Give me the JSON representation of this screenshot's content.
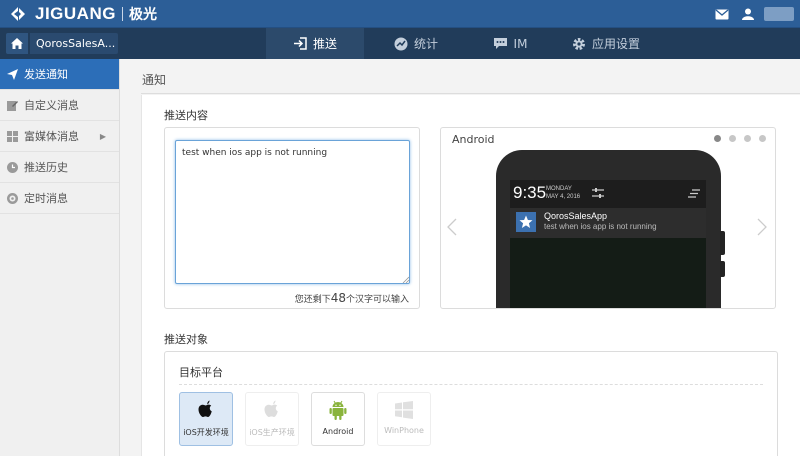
{
  "header": {
    "brand": "JIGUANG",
    "brand_cn": "极光"
  },
  "nav": {
    "app_name": "QorosSalesA...",
    "tabs": [
      {
        "label": "推送",
        "icon": "push-icon",
        "active": true
      },
      {
        "label": "统计",
        "icon": "stats-icon",
        "active": false
      },
      {
        "label": "IM",
        "icon": "chat-icon",
        "active": false
      },
      {
        "label": "应用设置",
        "icon": "gear-icon",
        "active": false
      }
    ]
  },
  "sidebar": {
    "items": [
      {
        "label": "发送通知",
        "icon": "send-icon",
        "active": true
      },
      {
        "label": "自定义消息",
        "icon": "edit-icon",
        "active": false
      },
      {
        "label": "富媒体消息",
        "icon": "grid-icon",
        "active": false,
        "has_submenu": true
      },
      {
        "label": "推送历史",
        "icon": "history-icon",
        "active": false
      },
      {
        "label": "定时消息",
        "icon": "timer-icon",
        "active": false
      }
    ]
  },
  "main": {
    "page_title": "通知",
    "content_section": "推送内容",
    "message_value": "test when ios app is not running",
    "remain_prefix": "您还剩下",
    "remain_count": "48",
    "remain_suffix": "个汉字可以输入",
    "target_section": "推送对象",
    "platform_label": "目标平台"
  },
  "preview": {
    "label": "Android",
    "time": "9:35",
    "weekday": "MONDAY",
    "date": "MAY 4, 2016",
    "notif_app": "QorosSalesApp",
    "notif_text": "test when ios app is not running",
    "active_dot": 0
  },
  "platforms": [
    {
      "label": "iOS开发环境",
      "icon": "apple-icon",
      "state": "selected"
    },
    {
      "label": "iOS生产环境",
      "icon": "apple-icon",
      "state": "disabled"
    },
    {
      "label": "Android",
      "icon": "android-icon",
      "state": "normal"
    },
    {
      "label": "WinPhone",
      "icon": "windows-icon",
      "state": "disabled"
    }
  ],
  "colors": {
    "topbar": "#2c5e97",
    "navbar": "#213c5a",
    "sidebar_active": "#2c6eb8",
    "android_green": "#8ab43c"
  }
}
